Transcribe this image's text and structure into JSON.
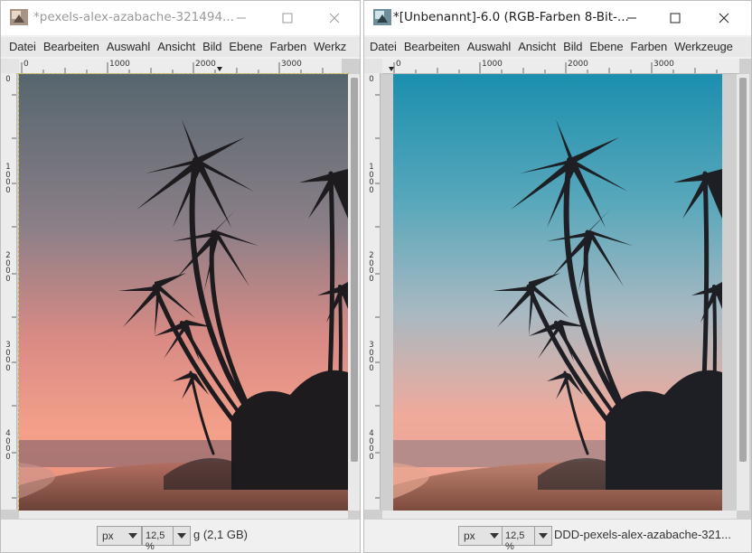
{
  "windows": [
    {
      "title": "*pexels-alex-azabache-321494...",
      "menu": [
        "Datei",
        "Bearbeiten",
        "Auswahl",
        "Ansicht",
        "Bild",
        "Ebene",
        "Farben",
        "Werkz"
      ],
      "ruler_h": [
        "0",
        "1000",
        "2000",
        "3000"
      ],
      "ruler_v": [
        "0",
        "1000",
        "2000",
        "3000",
        "4000"
      ],
      "unit": "px",
      "zoom": "12,5 %",
      "status": "g (2,1 GB)",
      "photo_tint": "warm-pink"
    },
    {
      "title": "*[Unbenannt]-6.0 (RGB-Farben 8-Bit-...",
      "menu": [
        "Datei",
        "Bearbeiten",
        "Auswahl",
        "Ansicht",
        "Bild",
        "Ebene",
        "Farben",
        "Werkzeuge"
      ],
      "ruler_h": [
        "0",
        "1000",
        "2000",
        "3000"
      ],
      "ruler_v": [
        "0",
        "1000",
        "2000",
        "3000",
        "4000"
      ],
      "unit": "px",
      "zoom": "12,5 %",
      "status": "DDD-pexels-alex-azabache-321...",
      "photo_tint": "teal-blue"
    }
  ],
  "icons": [
    "gimp-app-icon",
    "minimize-icon",
    "maximize-icon",
    "close-icon",
    "chevron-down-icon"
  ],
  "colors": {
    "sky_top_warm": "#5a6a74",
    "sky_bottom_warm": "#f29a86",
    "sky_top_teal": "#1f93b0",
    "sky_bottom_teal": "#f0a898",
    "palm": "#1d1b1e"
  }
}
